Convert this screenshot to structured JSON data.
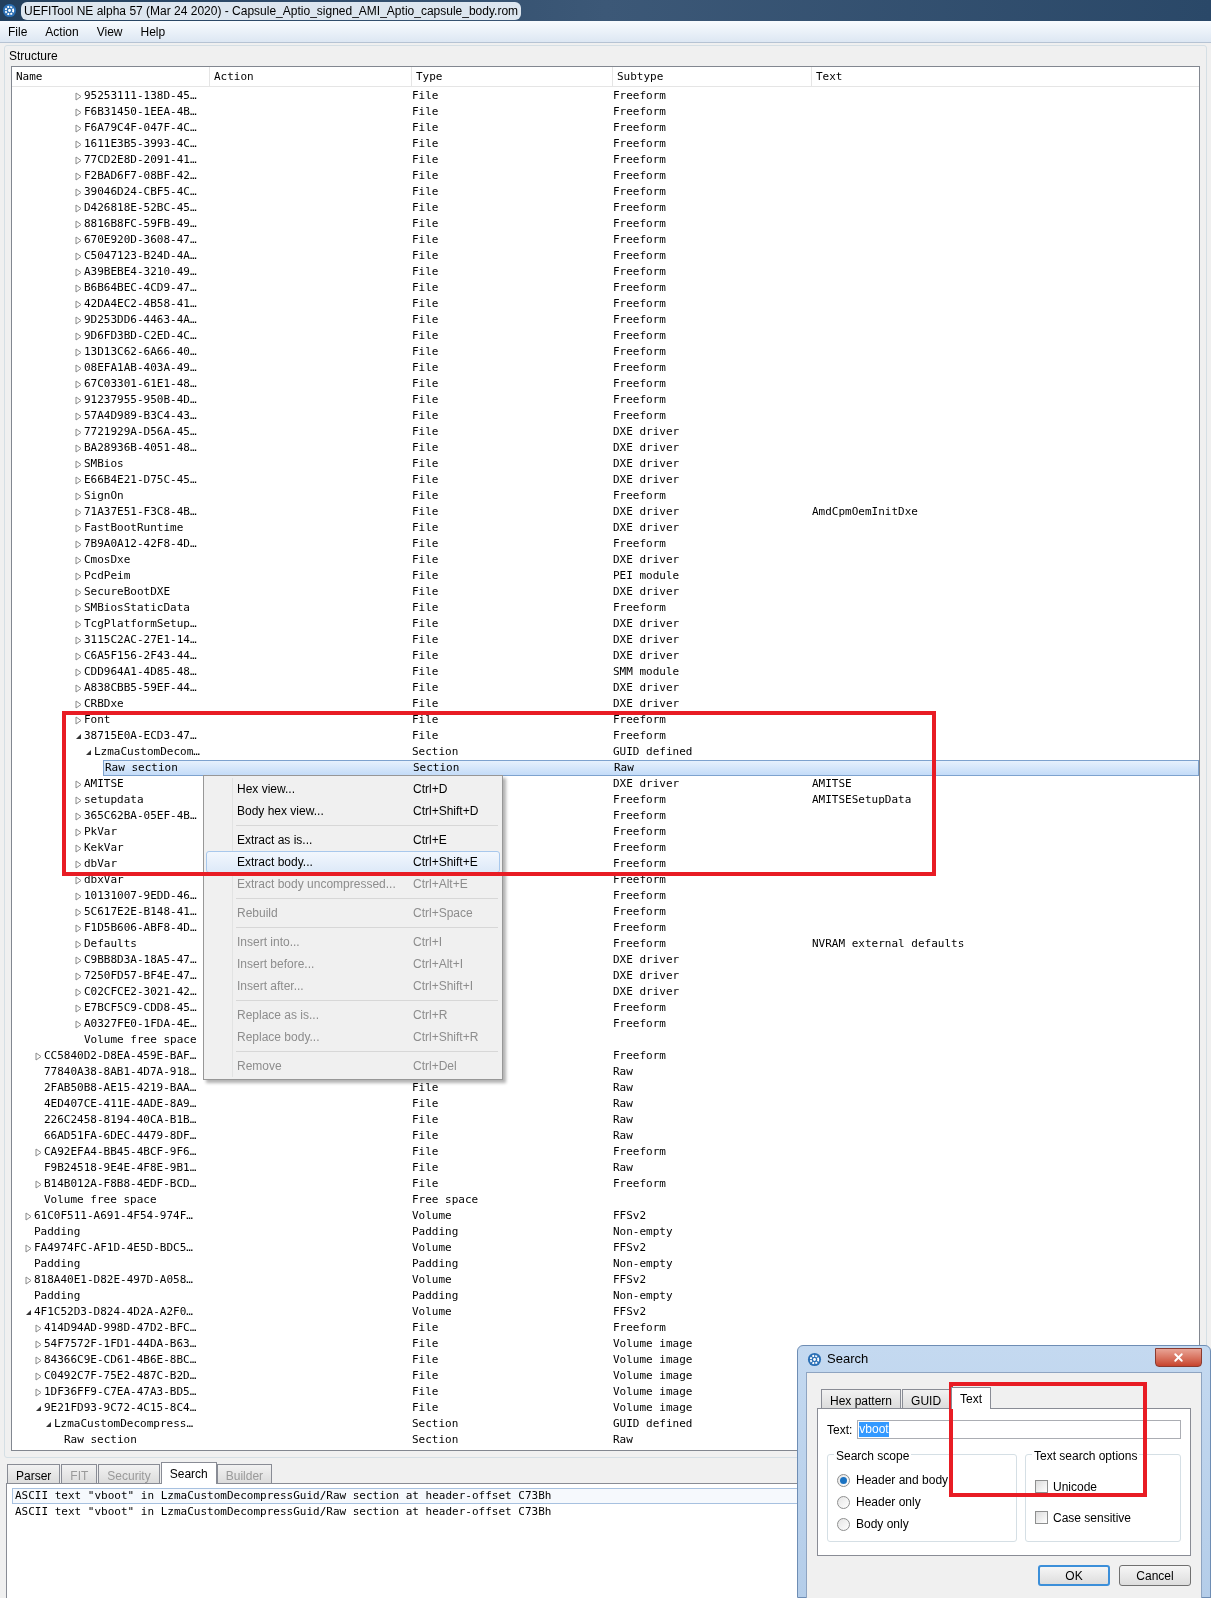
{
  "window": {
    "title": "UEFITool NE alpha 57 (Mar 24 2020) - Capsule_Aptio_signed_AMI_Aptio_capsule_body.rom"
  },
  "menu": [
    "File",
    "Action",
    "View",
    "Help"
  ],
  "structure": {
    "title": "Structure",
    "columns": [
      "Name",
      "Action",
      "Type",
      "Subtype",
      "Text"
    ],
    "rows": [
      {
        "children": [
          {
            "children": [
              {
                "children": [
                  {
                    "children": [
                      {
                        "children": [
                          {
                            "name": "95253111-138D-45…",
                            "type": "File",
                            "subtype": "Freeform",
                            "expanded": false,
                            "selected": false
                          },
                          {
                            "name": "F6B31450-1EEA-4B…",
                            "type": "File",
                            "subtype": "Freeform",
                            "expanded": false,
                            "selected": false
                          },
                          {
                            "name": "F6A79C4F-047F-4C…",
                            "type": "File",
                            "subtype": "Freeform",
                            "expanded": false,
                            "selected": false
                          },
                          {
                            "name": "1611E3B5-3993-4C…",
                            "type": "File",
                            "subtype": "Freeform",
                            "expanded": false,
                            "selected": false
                          },
                          {
                            "name": "77CD2E8D-2091-41…",
                            "type": "File",
                            "subtype": "Freeform",
                            "expanded": false,
                            "selected": false
                          },
                          {
                            "name": "F2BAD6F7-08BF-42…",
                            "type": "File",
                            "subtype": "Freeform",
                            "expanded": false,
                            "selected": false
                          },
                          {
                            "name": "39046D24-CBF5-4C…",
                            "type": "File",
                            "subtype": "Freeform",
                            "expanded": false,
                            "selected": false
                          },
                          {
                            "name": "D426818E-52BC-45…",
                            "type": "File",
                            "subtype": "Freeform",
                            "expanded": false,
                            "selected": false
                          },
                          {
                            "name": "8816B8FC-59FB-49…",
                            "type": "File",
                            "subtype": "Freeform",
                            "expanded": false,
                            "selected": false
                          },
                          {
                            "name": "670E920D-3608-47…",
                            "type": "File",
                            "subtype": "Freeform",
                            "expanded": false,
                            "selected": false
                          },
                          {
                            "name": "C5047123-B24D-4A…",
                            "type": "File",
                            "subtype": "Freeform",
                            "expanded": false,
                            "selected": false
                          },
                          {
                            "name": "A39BEBE4-3210-49…",
                            "type": "File",
                            "subtype": "Freeform",
                            "expanded": false,
                            "selected": false
                          },
                          {
                            "name": "B6B64BEC-4CD9-47…",
                            "type": "File",
                            "subtype": "Freeform",
                            "expanded": false,
                            "selected": false
                          },
                          {
                            "name": "42DA4EC2-4B58-41…",
                            "type": "File",
                            "subtype": "Freeform",
                            "expanded": false,
                            "selected": false
                          },
                          {
                            "name": "9D253DD6-4463-4A…",
                            "type": "File",
                            "subtype": "Freeform",
                            "expanded": false,
                            "selected": false
                          },
                          {
                            "name": "9D6FD3BD-C2ED-4C…",
                            "type": "File",
                            "subtype": "Freeform",
                            "expanded": false,
                            "selected": false
                          },
                          {
                            "name": "13D13C62-6A66-40…",
                            "type": "File",
                            "subtype": "Freeform",
                            "expanded": false,
                            "selected": false
                          },
                          {
                            "name": "08EFA1AB-403A-49…",
                            "type": "File",
                            "subtype": "Freeform",
                            "expanded": false,
                            "selected": false
                          },
                          {
                            "name": "67C03301-61E1-48…",
                            "type": "File",
                            "subtype": "Freeform",
                            "expanded": false,
                            "selected": false
                          },
                          {
                            "name": "91237955-950B-4D…",
                            "type": "File",
                            "subtype": "Freeform",
                            "expanded": false,
                            "selected": false
                          },
                          {
                            "name": "57A4D989-B3C4-43…",
                            "type": "File",
                            "subtype": "Freeform",
                            "expanded": false,
                            "selected": false
                          },
                          {
                            "name": "7721929A-D56A-45…",
                            "type": "File",
                            "subtype": "DXE driver",
                            "expanded": false,
                            "selected": false
                          },
                          {
                            "name": "BA28936B-4051-48…",
                            "type": "File",
                            "subtype": "DXE driver",
                            "expanded": false,
                            "selected": false
                          },
                          {
                            "name": "SMBios",
                            "type": "File",
                            "subtype": "DXE driver",
                            "expanded": false,
                            "selected": false
                          },
                          {
                            "name": "E66B4E21-D75C-45…",
                            "type": "File",
                            "subtype": "DXE driver",
                            "expanded": false,
                            "selected": false
                          },
                          {
                            "name": "SignOn",
                            "type": "File",
                            "subtype": "Freeform",
                            "expanded": false,
                            "selected": false
                          },
                          {
                            "name": "71A37E51-F3C8-4B…",
                            "type": "File",
                            "subtype": "DXE driver",
                            "text": "AmdCpmOemInitDxe",
                            "expanded": false,
                            "selected": false
                          },
                          {
                            "name": "FastBootRuntime",
                            "type": "File",
                            "subtype": "DXE driver",
                            "expanded": false,
                            "selected": false
                          },
                          {
                            "name": "7B9A0A12-42F8-4D…",
                            "type": "File",
                            "subtype": "Freeform",
                            "expanded": false,
                            "selected": false
                          },
                          {
                            "name": "CmosDxe",
                            "type": "File",
                            "subtype": "DXE driver",
                            "expanded": false,
                            "selected": false
                          },
                          {
                            "name": "PcdPeim",
                            "type": "File",
                            "subtype": "PEI module",
                            "expanded": false,
                            "selected": false
                          },
                          {
                            "name": "SecureBootDXE",
                            "type": "File",
                            "subtype": "DXE driver",
                            "expanded": false,
                            "selected": false
                          },
                          {
                            "name": "SMBiosStaticData",
                            "type": "File",
                            "subtype": "Freeform",
                            "expanded": false,
                            "selected": false
                          },
                          {
                            "name": "TcgPlatformSetup…",
                            "type": "File",
                            "subtype": "DXE driver",
                            "expanded": false,
                            "selected": false
                          },
                          {
                            "name": "3115C2AC-27E1-14…",
                            "type": "File",
                            "subtype": "DXE driver",
                            "expanded": false,
                            "selected": false
                          },
                          {
                            "name": "C6A5F156-2F43-44…",
                            "type": "File",
                            "subtype": "DXE driver",
                            "expanded": false,
                            "selected": false
                          },
                          {
                            "name": "CDD964A1-4D85-48…",
                            "type": "File",
                            "subtype": "SMM module",
                            "expanded": false,
                            "selected": false
                          },
                          {
                            "name": "A838CBB5-59EF-44…",
                            "type": "File",
                            "subtype": "DXE driver",
                            "expanded": false,
                            "selected": false
                          },
                          {
                            "name": "CRBDxe",
                            "type": "File",
                            "subtype": "DXE driver",
                            "expanded": false,
                            "selected": false
                          },
                          {
                            "name": "Font",
                            "type": "File",
                            "subtype": "Freeform",
                            "expanded": false,
                            "selected": false
                          },
                          {
                            "name": "38715E0A-ECD3-47…",
                            "type": "File",
                            "subtype": "Freeform",
                            "expanded": true,
                            "selected": false,
                            "children": [
                              {
                                "name": "LzmaCustomDecom…",
                                "type": "Section",
                                "subtype": "GUID defined",
                                "expanded": true,
                                "selected": false,
                                "children": [
                                  {
                                    "name": "Raw section",
                                    "type": "Section",
                                    "subtype": "Raw",
                                    "selected": true
                                  }
                                ]
                              }
                            ]
                          },
                          {
                            "name": "AMITSE",
                            "subtype": "DXE driver",
                            "text": "AMITSE",
                            "expanded": false,
                            "selected": false
                          },
                          {
                            "name": "setupdata",
                            "subtype": "Freeform",
                            "text": "AMITSESetupData",
                            "expanded": false,
                            "selected": false
                          },
                          {
                            "name": "365C62BA-05EF-4B…",
                            "subtype": "Freeform",
                            "expanded": false,
                            "selected": false
                          },
                          {
                            "name": "PkVar",
                            "subtype": "Freeform",
                            "expanded": false,
                            "selected": false
                          },
                          {
                            "name": "KekVar",
                            "subtype": "Freeform",
                            "expanded": false,
                            "selected": false
                          },
                          {
                            "name": "dbVar",
                            "subtype": "Freeform",
                            "expanded": false,
                            "selected": false
                          },
                          {
                            "name": "dbxVar",
                            "subtype": "Freeform",
                            "expanded": false,
                            "selected": false
                          },
                          {
                            "name": "10131007-9EDD-46…",
                            "subtype": "Freeform",
                            "expanded": false,
                            "selected": false
                          },
                          {
                            "name": "5C617E2E-B148-41…",
                            "subtype": "Freeform",
                            "expanded": false,
                            "selected": false
                          },
                          {
                            "name": "F1D5B606-ABF8-4D…",
                            "subtype": "Freeform",
                            "expanded": false,
                            "selected": false
                          },
                          {
                            "name": "Defaults",
                            "subtype": "Freeform",
                            "text": "NVRAM external defaults",
                            "expanded": false,
                            "selected": false
                          },
                          {
                            "name": "C9BB8D3A-18A5-47…",
                            "subtype": "DXE driver",
                            "expanded": false,
                            "selected": false
                          },
                          {
                            "name": "7250FD57-BF4E-47…",
                            "subtype": "DXE driver",
                            "expanded": false,
                            "selected": false
                          },
                          {
                            "name": "C02CFCE2-3021-42…",
                            "subtype": "DXE driver",
                            "expanded": false,
                            "selected": false
                          },
                          {
                            "name": "E7BCF5C9-CDD8-45…",
                            "subtype": "Freeform",
                            "expanded": false,
                            "selected": false
                          },
                          {
                            "name": "A0327FE0-1FDA-4E…",
                            "subtype": "Freeform",
                            "expanded": false,
                            "selected": false
                          },
                          {
                            "name": "Volume free space",
                            "selected": false
                          }
                        ]
                      }
                    ]
                  }
                ]
              }
            ]
          },
          {
            "name": "CC5840D2-D8EA-459E-BAF…",
            "subtype": "Freeform",
            "expanded": false,
            "selected": false
          },
          {
            "name": "77840A38-8AB1-4D7A-918…",
            "subtype": "Raw",
            "selected": false
          },
          {
            "name": "2FAB50B8-AE15-4219-BAA…",
            "type": "File",
            "subtype": "Raw",
            "selected": false
          },
          {
            "name": "4ED407CE-411E-4ADE-8A9…",
            "type": "File",
            "subtype": "Raw",
            "selected": false
          },
          {
            "name": "226C2458-8194-40CA-B1B…",
            "type": "File",
            "subtype": "Raw",
            "selected": false
          },
          {
            "name": "66AD51FA-6DEC-4479-8DF…",
            "type": "File",
            "subtype": "Raw",
            "selected": false
          },
          {
            "name": "CA92EFA4-BB45-4BCF-9F6…",
            "type": "File",
            "subtype": "Freeform",
            "expanded": false,
            "selected": false
          },
          {
            "name": "F9B24518-9E4E-4F8E-9B1…",
            "type": "File",
            "subtype": "Raw",
            "selected": false
          },
          {
            "name": "B14B012A-F8B8-4EDF-BCD…",
            "type": "File",
            "subtype": "Freeform",
            "expanded": false,
            "selected": false
          },
          {
            "name": "Volume free space",
            "type": "Free space",
            "selected": false
          }
        ]
      },
      {
        "name": "61C0F511-A691-4F54-974F…",
        "type": "Volume",
        "subtype": "FFSv2",
        "expanded": false,
        "selected": false
      },
      {
        "name": "Padding",
        "type": "Padding",
        "subtype": "Non-empty",
        "selected": false
      },
      {
        "name": "FA4974FC-AF1D-4E5D-BDC5…",
        "type": "Volume",
        "subtype": "FFSv2",
        "expanded": false,
        "selected": false
      },
      {
        "name": "Padding",
        "type": "Padding",
        "subtype": "Non-empty",
        "selected": false
      },
      {
        "name": "818A40E1-D82E-497D-A058…",
        "type": "Volume",
        "subtype": "FFSv2",
        "expanded": false,
        "selected": false
      },
      {
        "name": "Padding",
        "type": "Padding",
        "subtype": "Non-empty",
        "selected": false
      },
      {
        "name": "4F1C52D3-D824-4D2A-A2F0…",
        "type": "Volume",
        "subtype": "FFSv2",
        "expanded": true,
        "selected": false,
        "children": [
          {
            "name": "414D94AD-998D-47D2-BFC…",
            "type": "File",
            "subtype": "Freeform",
            "expanded": false,
            "selected": false
          },
          {
            "name": "54F7572F-1FD1-44DA-B63…",
            "type": "File",
            "subtype": "Volume image",
            "expanded": false,
            "selected": false
          },
          {
            "name": "84366C9E-CD61-4B6E-8BC…",
            "type": "File",
            "subtype": "Volume image",
            "expanded": false,
            "selected": false
          },
          {
            "name": "C0492C7F-75E2-487C-B2D…",
            "type": "File",
            "subtype": "Volume image",
            "expanded": false,
            "selected": false
          },
          {
            "name": "1DF36FF9-C7EA-47A3-BD5…",
            "type": "File",
            "subtype": "Volume image",
            "expanded": false,
            "selected": false
          },
          {
            "name": "9E21FD93-9C72-4C15-8C4…",
            "type": "File",
            "subtype": "Volume image",
            "expanded": true,
            "selected": false,
            "children": [
              {
                "name": "LzmaCustomDecompress…",
                "type": "Section",
                "subtype": "GUID defined",
                "expanded": true,
                "selected": false,
                "children": [
                  {
                    "name": "Raw section",
                    "type": "Section",
                    "subtype": "Raw",
                    "selected": false
                  }
                ]
              }
            ]
          }
        ]
      }
    ]
  },
  "context_menu": {
    "groups": [
      [
        {
          "label": "Hex view...",
          "shortcut": "Ctrl+D",
          "disabled": false,
          "selected": false
        },
        {
          "label": "Body hex view...",
          "shortcut": "Ctrl+Shift+D",
          "disabled": false,
          "selected": false
        }
      ],
      [
        {
          "label": "Extract as is...",
          "shortcut": "Ctrl+E",
          "disabled": false,
          "selected": false
        },
        {
          "label": "Extract body...",
          "shortcut": "Ctrl+Shift+E",
          "disabled": false,
          "selected": true
        },
        {
          "label": "Extract body uncompressed...",
          "shortcut": "Ctrl+Alt+E",
          "disabled": true,
          "selected": false
        }
      ],
      [
        {
          "label": "Rebuild",
          "shortcut": "Ctrl+Space",
          "disabled": true,
          "selected": false
        }
      ],
      [
        {
          "label": "Insert into...",
          "shortcut": "Ctrl+I",
          "disabled": true,
          "selected": false
        },
        {
          "label": "Insert before...",
          "shortcut": "Ctrl+Alt+I",
          "disabled": true,
          "selected": false
        },
        {
          "label": "Insert after...",
          "shortcut": "Ctrl+Shift+I",
          "disabled": true,
          "selected": false
        }
      ],
      [
        {
          "label": "Replace as is...",
          "shortcut": "Ctrl+R",
          "disabled": true,
          "selected": false
        },
        {
          "label": "Replace body...",
          "shortcut": "Ctrl+Shift+R",
          "disabled": true,
          "selected": false
        }
      ],
      [
        {
          "label": "Remove",
          "shortcut": "Ctrl+Del",
          "disabled": true,
          "selected": false
        }
      ]
    ]
  },
  "bottom_tabs": [
    {
      "label": "Parser",
      "selected": false,
      "disabled": false
    },
    {
      "label": "FIT",
      "selected": false,
      "disabled": true
    },
    {
      "label": "Security",
      "selected": false,
      "disabled": true
    },
    {
      "label": "Search",
      "selected": true,
      "disabled": false
    },
    {
      "label": "Builder",
      "selected": false,
      "disabled": true
    }
  ],
  "messages": [
    {
      "text": "ASCII text \"vboot\" in LzmaCustomDecompressGuid/Raw section at header-offset C73Bh",
      "selected": true
    },
    {
      "text": "ASCII text \"vboot\" in LzmaCustomDecompressGuid/Raw section at header-offset C73Bh",
      "selected": false
    }
  ],
  "search_dialog": {
    "title": "Search",
    "tabs": [
      {
        "label": "Hex pattern",
        "selected": false
      },
      {
        "label": "GUID",
        "selected": false
      },
      {
        "label": "Text",
        "selected": true
      }
    ],
    "text_label": "Text:",
    "text_value": "vboot",
    "scope": {
      "title": "Search scope",
      "options": [
        {
          "label": "Header and body",
          "selected": true
        },
        {
          "label": "Header only",
          "selected": false
        },
        {
          "label": "Body only",
          "selected": false
        }
      ]
    },
    "options": {
      "title": "Text search options",
      "items": [
        {
          "label": "Unicode",
          "checked": false
        },
        {
          "label": "Case sensitive",
          "checked": false
        }
      ]
    },
    "buttons": [
      {
        "label": "OK",
        "default": true
      },
      {
        "label": "Cancel",
        "default": false
      }
    ]
  }
}
